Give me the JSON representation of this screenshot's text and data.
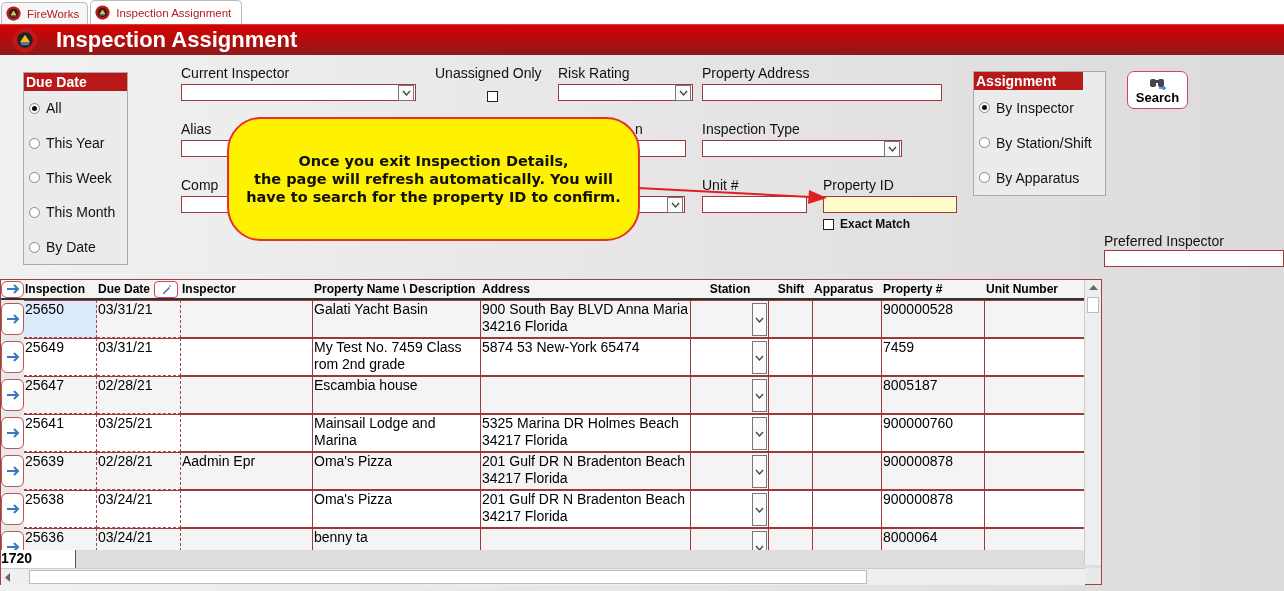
{
  "app_tabs": [
    {
      "label": "FireWorks",
      "selected": false
    },
    {
      "label": "Inspection Assignment",
      "selected": true
    }
  ],
  "header": {
    "title": "Inspection Assignment"
  },
  "due_date": {
    "title": "Due Date",
    "options": [
      {
        "label": "All",
        "selected": true
      },
      {
        "label": "This Year",
        "selected": false
      },
      {
        "label": "This Week",
        "selected": false
      },
      {
        "label": "This Month",
        "selected": false
      },
      {
        "label": "By Date",
        "selected": false
      }
    ]
  },
  "filter_rows": [
    [
      {
        "kind": "dropdown",
        "label": "Current Inspector"
      },
      {
        "kind": "checkbox",
        "label": "Unassigned Only",
        "checked": false
      },
      {
        "kind": "dropdown",
        "label": "Risk Rating"
      },
      {
        "kind": "text",
        "label": "Property Address"
      }
    ],
    [
      {
        "kind": "text",
        "label": "Alias"
      },
      {
        "kind": "text",
        "label": "n"
      },
      {
        "kind": "dropdown",
        "label": "Inspection Type"
      }
    ],
    [
      {
        "kind": "text",
        "label": "Comp"
      },
      {
        "kind": "dropdown"
      },
      {
        "kind": "text",
        "label": "Unit #"
      },
      {
        "kind": "highlighted",
        "label": "Property ID",
        "option": {
          "label": "Exact Match",
          "checked": false
        }
      }
    ]
  ],
  "callout": {
    "lines": [
      "Once you exit Inspection Details,",
      "the page will refresh automatically. You will",
      "have to search for the property ID to confirm."
    ]
  },
  "assignment": {
    "title": "Assignment",
    "options": [
      {
        "label": "By Inspector",
        "selected": true
      },
      {
        "label": "By Station/Shift",
        "selected": false
      },
      {
        "label": "By Apparatus",
        "selected": false
      }
    ]
  },
  "search_button": {
    "label": "Search"
  },
  "preferred_inspector": {
    "label": "Preferred Inspector"
  },
  "table": {
    "columns": [
      "Inspection",
      "Due Date",
      "Inspector",
      "Property Name \\ Description",
      "Address",
      "Station",
      "Shift",
      "Apparatus",
      "Property #",
      "Unit Number"
    ],
    "rows": [
      {
        "selected": true,
        "cells": [
          "25650",
          "03/31/21",
          "",
          "Galati Yacht Basin",
          "900 South Bay BLVD  Anna Maria 34216 Florida",
          "",
          "",
          "",
          "900000528",
          ""
        ]
      },
      {
        "selected": false,
        "cells": [
          "25649",
          "03/31/21",
          "",
          "My Test No. 7459 Class rom 2nd grade",
          "5874 53 New-York 65474",
          "",
          "",
          "",
          "7459",
          ""
        ]
      },
      {
        "selected": false,
        "cells": [
          "25647",
          "02/28/21",
          "",
          "Escambia house",
          "",
          "",
          "",
          "",
          "8005187",
          ""
        ]
      },
      {
        "selected": false,
        "cells": [
          "25641",
          "03/25/21",
          "",
          "Mainsail Lodge and Marina",
          "5325 Marina DR  Holmes Beach 34217 Florida",
          "",
          "",
          "",
          "900000760",
          ""
        ]
      },
      {
        "selected": false,
        "cells": [
          "25639",
          "02/28/21",
          "Aadmin Epr",
          "Oma's Pizza",
          "201 Gulf DR N Bradenton Beach 34217 Florida",
          "",
          "",
          "",
          "900000878",
          ""
        ]
      },
      {
        "selected": false,
        "cells": [
          "25638",
          "03/24/21",
          "",
          "Oma's Pizza",
          "201 Gulf DR N Bradenton Beach 34217 Florida",
          "",
          "",
          "",
          "900000878",
          ""
        ]
      },
      {
        "selected": false,
        "cells": [
          "25636",
          "03/24/21",
          "",
          "benny ta",
          "",
          "",
          "",
          "",
          "8000064",
          ""
        ]
      }
    ],
    "record_count": "1720"
  }
}
